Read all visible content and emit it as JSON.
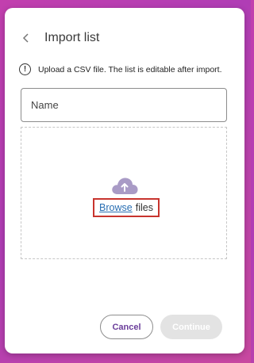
{
  "dialog": {
    "title": "Import list",
    "info_text": "Upload a CSV file. The list is editable after import.",
    "name_field": {
      "placeholder": "Name",
      "value": ""
    },
    "dropzone": {
      "browse_link": "Browse",
      "files_text": "files",
      "icon": "cloud-upload-icon"
    },
    "cancel_label": "Cancel",
    "continue_label": "Continue"
  },
  "colors": {
    "accent": "#6a3d9a",
    "link": "#2a6fb3",
    "highlight": "#c8342e",
    "cloud": "#a99bc6",
    "disabled": "#e3e3e3"
  }
}
